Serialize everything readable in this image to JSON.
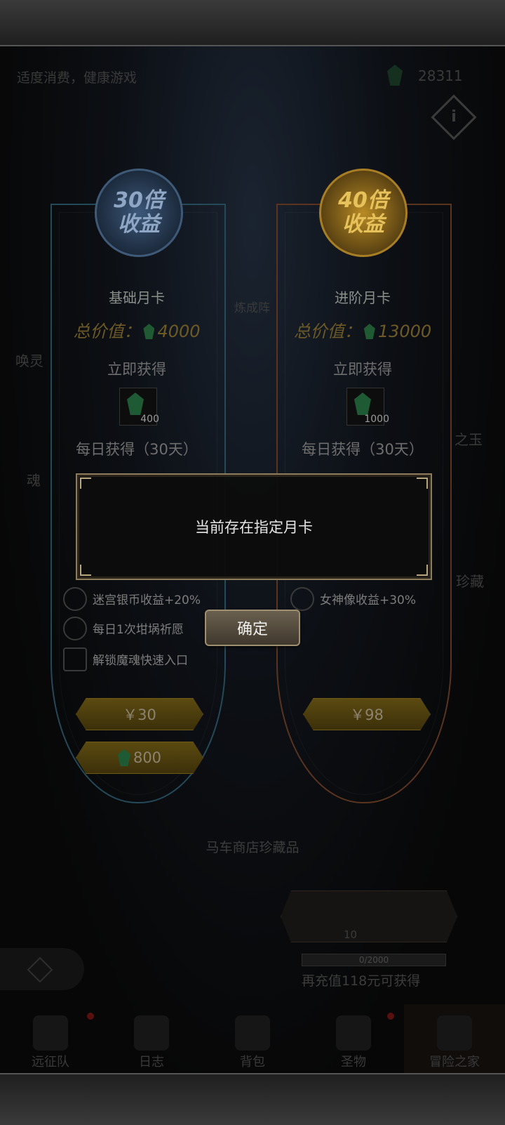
{
  "header": {
    "hint": "适度消费，健康游戏",
    "gems": "28311",
    "info_label": "i"
  },
  "side_labels": {
    "left1": "唤灵",
    "left2": "魂",
    "right1": "之玉",
    "right2": "珍藏",
    "center": "炼成阵"
  },
  "cards": [
    {
      "badge_line1": "30倍",
      "badge_line2": "收益",
      "title": "基础月卡",
      "total_label": "总价值：",
      "total_value": "4000",
      "instant_label": "立即获得",
      "instant_qty": "400",
      "daily_label": "每日获得（30天）",
      "benefits": [
        "迷宫银币收益+20%",
        "每日1次坩埚祈愿",
        "解锁魔魂快速入口"
      ],
      "price": "￥30",
      "gem_price": "800"
    },
    {
      "badge_line1": "40倍",
      "badge_line2": "收益",
      "title": "进阶月卡",
      "total_label": "总价值：",
      "total_value": "13000",
      "instant_label": "立即获得",
      "instant_qty": "1000",
      "daily_label": "每日获得（30天）",
      "benefits": [
        "女神像收益+30%"
      ],
      "price": "￥98"
    }
  ],
  "shop": {
    "label": "马车商店珍藏品",
    "reward_qty": "10",
    "progress_text": "0/2000",
    "progress_fraction": 0.0,
    "recharge_hint": "再充值118元可获得"
  },
  "nav": [
    "远征队",
    "日志",
    "背包",
    "圣物",
    "冒险之家"
  ],
  "modal": {
    "message": "当前存在指定月卡",
    "confirm": "确定"
  }
}
